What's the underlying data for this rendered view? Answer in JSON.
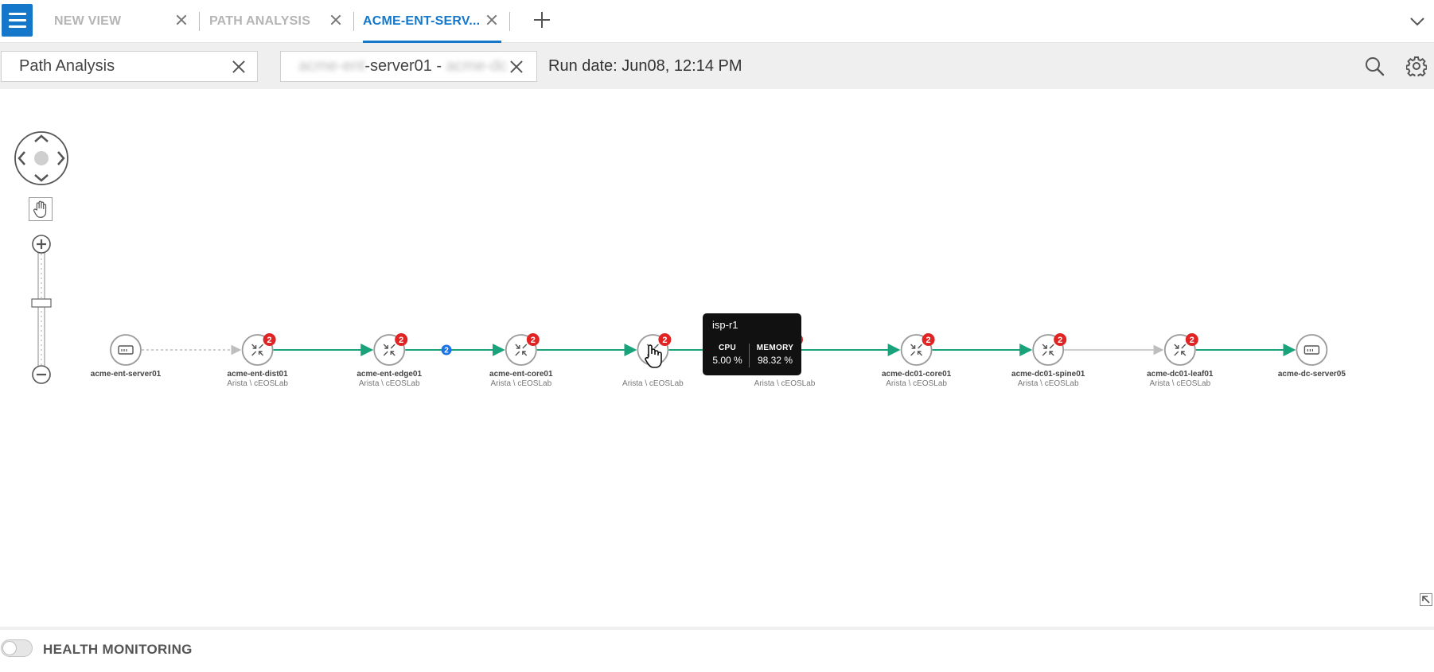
{
  "tabs": [
    {
      "label": "NEW VIEW",
      "active": false
    },
    {
      "label": "PATH ANALYSIS",
      "active": false
    },
    {
      "label": "ACME-ENT-SERV...",
      "active": true
    }
  ],
  "toolbar": {
    "view_name": "Path Analysis",
    "path_field": {
      "prefix_blurred": "acme-ent",
      "middle": "-server01 - ",
      "suffix_blurred": "acme-dc"
    },
    "run_date": "Run date: Jun08, 12:14 PM"
  },
  "icons": {
    "menu": "hamburger-menu-icon",
    "add_tab": "plus-icon",
    "collapse": "chevron-down-icon",
    "search": "search-icon",
    "settings": "gear-icon",
    "pan": "hand-icon",
    "expand": "expand-corner-icon"
  },
  "colors": {
    "accent": "#1477c9",
    "link_ok": "#1aa37a",
    "link_gray": "#bdbdbd",
    "alert_badge": "#e02424",
    "info_badge": "#1a73e8"
  },
  "nodes": [
    {
      "name": "acme-ent-server01",
      "sub": "",
      "type": "server",
      "badge": ""
    },
    {
      "name": "acme-ent-dist01",
      "sub": "Arista \\ cEOSLab",
      "type": "router",
      "badge": "2"
    },
    {
      "name": "acme-ent-edge01",
      "sub": "Arista \\ cEOSLab",
      "type": "router",
      "badge": "2"
    },
    {
      "name": "acme-ent-core01",
      "sub": "Arista \\ cEOSLab",
      "type": "router",
      "badge": "2"
    },
    {
      "name": "isp-r1",
      "sub": "Arista \\ cEOSLab",
      "type": "router",
      "badge": "2"
    },
    {
      "name": "",
      "sub": "Arista \\ cEOSLab",
      "type": "router",
      "badge": "2"
    },
    {
      "name": "acme-dc01-core01",
      "sub": "Arista \\ cEOSLab",
      "type": "router",
      "badge": "2"
    },
    {
      "name": "acme-dc01-spine01",
      "sub": "Arista \\ cEOSLab",
      "type": "router",
      "badge": "2"
    },
    {
      "name": "acme-dc01-leaf01",
      "sub": "Arista \\ cEOSLab",
      "type": "router",
      "badge": "2"
    },
    {
      "name": "acme-dc-server05",
      "sub": "",
      "type": "server",
      "badge": ""
    }
  ],
  "links": [
    {
      "style": "dotted-gray",
      "badge": ""
    },
    {
      "style": "green",
      "badge": ""
    },
    {
      "style": "green",
      "badge": "2"
    },
    {
      "style": "green",
      "badge": ""
    },
    {
      "style": "green",
      "badge": ""
    },
    {
      "style": "green",
      "badge": ""
    },
    {
      "style": "green",
      "badge": ""
    },
    {
      "style": "gray",
      "badge": ""
    },
    {
      "style": "green",
      "badge": ""
    }
  ],
  "tooltip": {
    "title": "isp-r1",
    "cpu_label": "CPU",
    "cpu_value": "5.00 %",
    "memory_label": "MEMORY",
    "memory_value": "98.32 %"
  },
  "footer": {
    "health_label": "HEALTH MONITORING",
    "health_enabled": false
  }
}
